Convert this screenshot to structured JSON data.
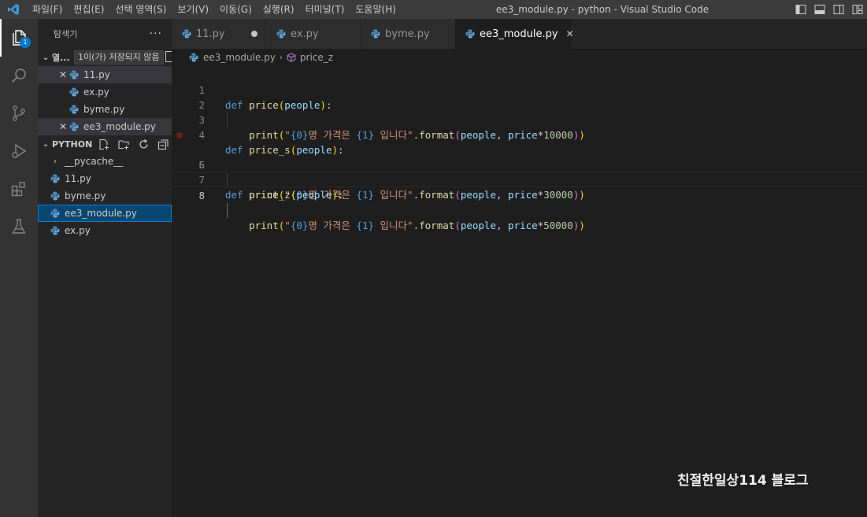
{
  "titlebar": {
    "menu": [
      "파일(F)",
      "편집(E)",
      "선택 영역(S)",
      "보기(V)",
      "이동(G)",
      "실행(R)",
      "터미널(T)",
      "도움말(H)"
    ],
    "window_title": "ee3_module.py - python - Visual Studio Code"
  },
  "activitybar": {
    "explorer_badge": "1"
  },
  "sidebar": {
    "title": "탐색기",
    "more": "···",
    "open_editors": {
      "label": "열...",
      "tooltip": "1이(가) 저장되지 않음",
      "files": [
        "11.py",
        "ex.py",
        "byme.py",
        "ee3_module.py"
      ]
    },
    "folder": {
      "label": "PYTHON",
      "items": [
        "__pycache__",
        "11.py",
        "byme.py",
        "ee3_module.py",
        "ex.py"
      ]
    }
  },
  "tabs": [
    "11.py",
    "ex.py",
    "byme.py",
    "ee3_module.py"
  ],
  "breadcrumb": {
    "file": "ee3_module.py",
    "symbol": "price_z"
  },
  "editor": {
    "line_numbers": [
      "1",
      "2",
      "3",
      "4",
      "5",
      "6",
      "7",
      "8"
    ],
    "tokens": {
      "def": "def",
      "fn1": "price",
      "fn2": "price_s",
      "fn3": "price_z",
      "param": "people",
      "print": "print",
      "str_pre": "\"",
      "ph0": "{0}",
      "str_mid": "명 가격은 ",
      "ph1": "{1}",
      "str_post": " 입니다\"",
      "format": "format",
      "price": "price",
      "n1": "10000",
      "n2": "30000",
      "n3": "50000"
    }
  },
  "watermark": "친절한일상114 블로그",
  "colors": {
    "accent": "#007acc",
    "keyword": "#569cd6",
    "function": "#dcdcaa",
    "string": "#ce9178",
    "number": "#b5cea8",
    "param": "#9cdcfe"
  }
}
